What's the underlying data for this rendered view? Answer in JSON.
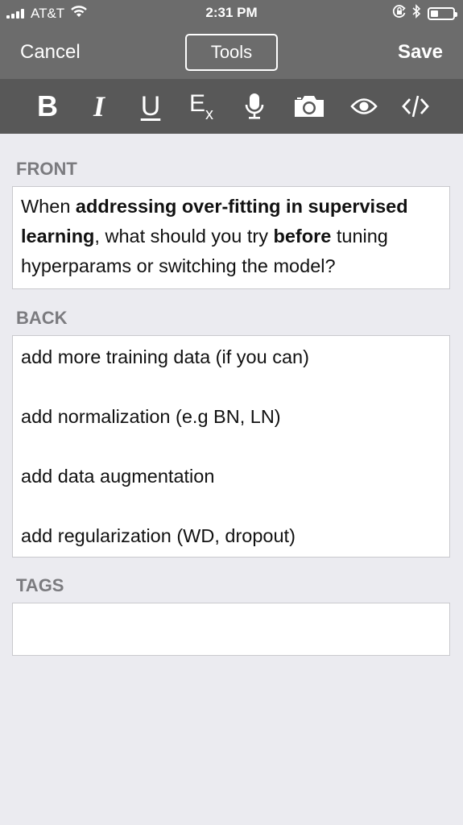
{
  "status_bar": {
    "carrier": "AT&T",
    "time": "2:31 PM",
    "battery_level": 0.35
  },
  "nav": {
    "cancel_label": "Cancel",
    "tools_label": "Tools",
    "save_label": "Save"
  },
  "toolbar": {
    "bold_label": "B",
    "italic_label": "I",
    "underline_label": "U",
    "clear_format_label": "E",
    "clear_format_sub": "x"
  },
  "front": {
    "label": "FRONT",
    "segments": [
      {
        "text": "When ",
        "bold": false
      },
      {
        "text": "addressing over-fitting in supervised learning",
        "bold": true
      },
      {
        "text": ", what should you try ",
        "bold": false
      },
      {
        "text": "before",
        "bold": true
      },
      {
        "text": " tuning hyperparams or switching the model?",
        "bold": false
      }
    ]
  },
  "back": {
    "label": "BACK",
    "lines": [
      "add more training data (if you can)",
      "add normalization (e.g BN, LN)",
      "add data augmentation",
      "add regularization (WD, dropout)"
    ]
  },
  "tags": {
    "label": "TAGS",
    "value": ""
  },
  "colors": {
    "nav_bg": "#6c6c6c",
    "toolbar_bg": "#585858",
    "page_bg": "#ebebf0",
    "label": "#7b7b7f"
  },
  "icons": [
    "bold-icon",
    "italic-icon",
    "underline-icon",
    "clear-format-icon",
    "microphone-icon",
    "camera-icon",
    "eye-icon",
    "code-icon",
    "wifi-icon",
    "lock-rotation-icon",
    "bluetooth-icon",
    "battery-icon",
    "signal-icon"
  ]
}
